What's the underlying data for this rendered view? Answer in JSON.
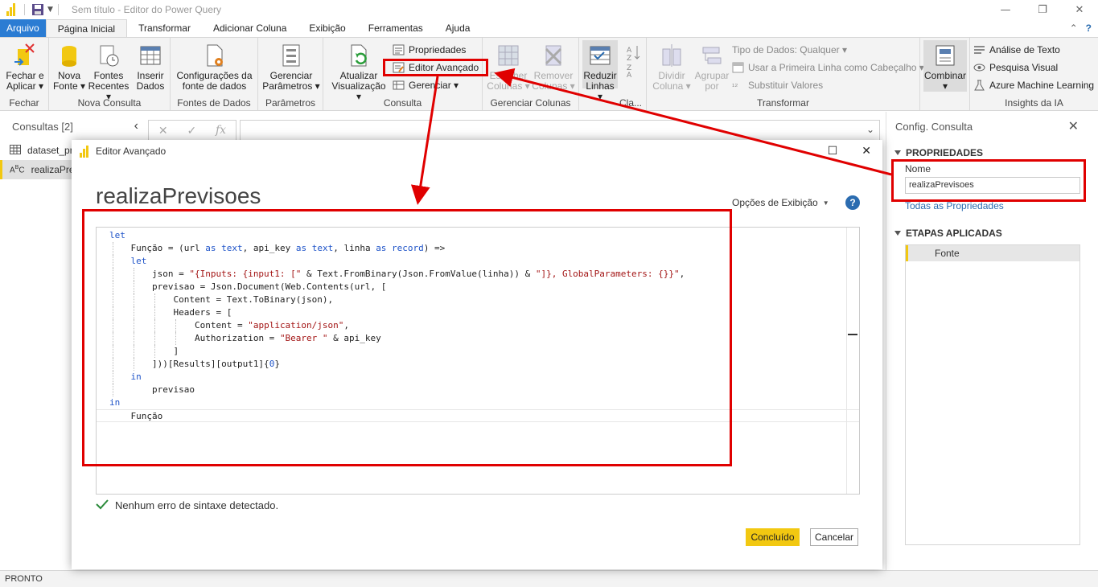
{
  "window": {
    "title": "Sem título - Editor do Power Query",
    "controls": [
      "minimize-icon",
      "restore-icon",
      "close-icon"
    ]
  },
  "ribbon_tabs": [
    "Arquivo",
    "Página Inicial",
    "Transformar",
    "Adicionar Coluna",
    "Exibição",
    "Ferramentas",
    "Ajuda"
  ],
  "ribbon": {
    "fechar": {
      "button": "Fechar e\nAplicar",
      "line1": "Fechar e",
      "line2": "Aplicar",
      "group": "Fechar"
    },
    "nova_consulta": {
      "nova_fonte_l1": "Nova",
      "nova_fonte_l2": "Fonte",
      "fontes_l1": "Fontes",
      "fontes_l2": "Recentes",
      "inserir_l1": "Inserir",
      "inserir_l2": "Dados",
      "group": "Nova Consulta"
    },
    "fontes_dados": {
      "btn_l1": "Configurações da",
      "btn_l2": "fonte de dados",
      "group": "Fontes de Dados"
    },
    "parametros": {
      "btn_l1": "Gerenciar",
      "btn_l2": "Parâmetros",
      "group": "Parâmetros"
    },
    "consulta": {
      "atualizar_l1": "Atualizar",
      "atualizar_l2": "Visualização",
      "propriedades": "Propriedades",
      "editor_avancado": "Editor Avançado",
      "gerenciar": "Gerenciar",
      "group": "Consulta"
    },
    "gerenciar_colunas": {
      "escolher_l1": "Escolher",
      "escolher_l2": "Colunas",
      "remover_l1": "Remover",
      "remover_l2": "Colunas",
      "group": "Gerenciar Colunas"
    },
    "reduzir": {
      "btn_l1": "Reduzir",
      "btn_l2": "Linhas",
      "group": "Cla..."
    },
    "transformar": {
      "dividir_l1": "Dividir",
      "dividir_l2": "Coluna",
      "agrupar_l1": "Agrupar",
      "agrupar_l2": "por",
      "tipo_dados": "Tipo de Dados: Qualquer",
      "primeira_linha": "Usar a Primeira Linha como Cabeçalho",
      "substituir": "Substituir Valores",
      "group": "Transformar"
    },
    "combinar": {
      "btn": "Combinar"
    },
    "insights": {
      "texto": "Análise de Texto",
      "visual": "Pesquisa Visual",
      "azure": "Azure Machine Learning",
      "group": "Insights da IA"
    }
  },
  "queries_pane": {
    "title": "Consultas [2]",
    "items": [
      {
        "name": "dataset_pr",
        "icon": "table-icon"
      },
      {
        "name": "realizaPrev",
        "icon": "text-type-icon"
      }
    ]
  },
  "formula_bar": {
    "icons": [
      "✕",
      "✓",
      "fx"
    ]
  },
  "settings_pane": {
    "title": "Config. Consulta",
    "properties_heading": "PROPRIEDADES",
    "name_label": "Nome",
    "name_value": "realizaPrevisoes",
    "all_properties": "Todas as Propriedades",
    "steps_heading": "ETAPAS APLICADAS",
    "steps": [
      "Fonte"
    ]
  },
  "status": "PRONTO",
  "dialog": {
    "title": "Editor Avançado",
    "heading": "realizaPrevisoes",
    "view_options": "Opções de Exibição",
    "syntax_status": "Nenhum erro de sintaxe detectado.",
    "ok_button": "Concluído",
    "cancel_button": "Cancelar",
    "code": {
      "l1": "let",
      "l2_a": "Função = (url ",
      "l2_as1": "as",
      "l2_t1": " text",
      "l2_b": ", api_key ",
      "l2_as2": "as",
      "l2_t2": " text",
      "l2_c": ", linha ",
      "l2_as3": "as",
      "l2_t3": " record",
      "l2_d": ") =>",
      "l3": "let",
      "l4_a": "json = ",
      "l4_s1": "\"{Inputs: {input1: [\"",
      "l4_b": " & Text.FromBinary(Json.FromValue(linha)) & ",
      "l4_s2": "\"]}, GlobalParameters: {}}\"",
      "l4_c": ",",
      "l5": "previsao = Json.Document(Web.Contents(url, [",
      "l6": "Content = Text.ToBinary(json),",
      "l7": "Headers = [",
      "l8_a": "Content = ",
      "l8_s": "\"application/json\"",
      "l8_b": ",",
      "l9_a": "Authorization = ",
      "l9_s": "\"Bearer \"",
      "l9_b": " & api_key",
      "l10": "]",
      "l11_a": "]))[Results][output1]{",
      "l11_n": "0",
      "l11_b": "}",
      "l12": "in",
      "l13": "previsao",
      "l14": "in",
      "l15": "Função"
    }
  },
  "colors": {
    "accent_blue": "#2b7cd3",
    "pbi_yellow": "#f2c811",
    "annotation_red": "#e00000",
    "keyword_blue": "#1e53c8",
    "string_red": "#a31515"
  }
}
